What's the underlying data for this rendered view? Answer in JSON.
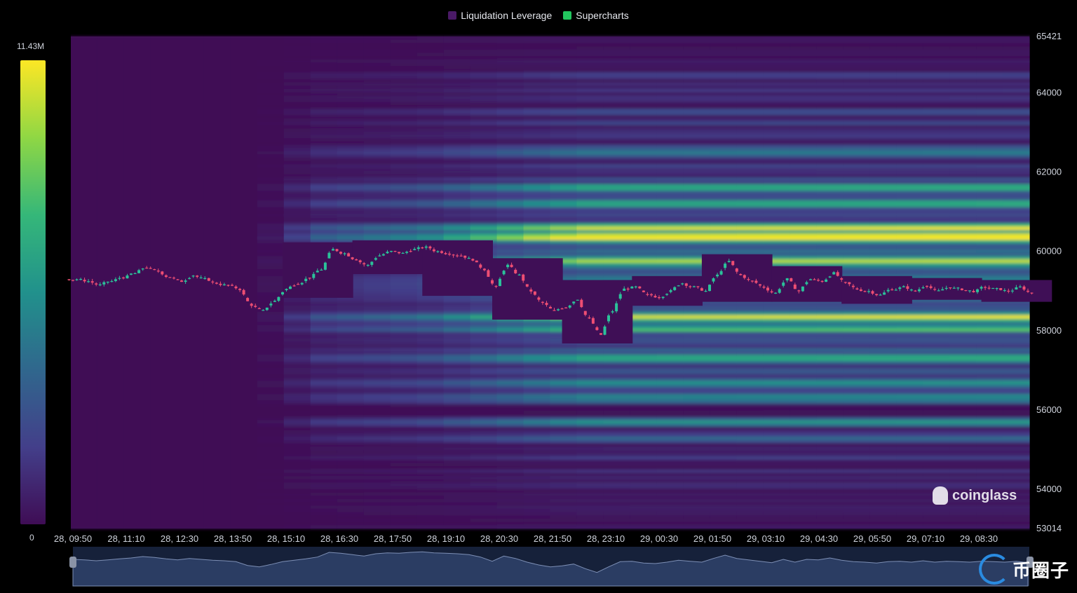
{
  "legend": {
    "items": [
      {
        "label": "Liquidation Leverage",
        "color": "#4a1a66"
      },
      {
        "label": "Supercharts",
        "color": "#22c55e"
      }
    ]
  },
  "colorscale": {
    "max_label": "11.43M",
    "min_label": "0",
    "stops": [
      "#3f0d55",
      "#433f8a",
      "#30678d",
      "#21918c",
      "#35b779",
      "#8fd744",
      "#fde725"
    ]
  },
  "watermark": {
    "text": "coinglass"
  },
  "brand": {
    "text": "币圈子"
  },
  "chart_data": {
    "type": "heatmap",
    "title": "",
    "x_ticks": [
      "28, 09:50",
      "28, 11:10",
      "28, 12:30",
      "28, 13:50",
      "28, 15:10",
      "28, 16:30",
      "28, 17:50",
      "28, 19:10",
      "28, 20:30",
      "28, 21:50",
      "28, 23:10",
      "29, 00:30",
      "29, 01:50",
      "29, 03:10",
      "29, 04:30",
      "29, 05:50",
      "29, 07:10",
      "29, 08:30"
    ],
    "y_ticks": [
      "65421",
      "64000",
      "62000",
      "60000",
      "58000",
      "56000",
      "54000",
      "53014"
    ],
    "ylim": [
      53014,
      65421
    ],
    "value_range": [
      0,
      11430000
    ],
    "series": [
      {
        "name": "Supercharts",
        "type": "candlestick",
        "close_path": [
          59300,
          59250,
          59150,
          59250,
          59350,
          59450,
          59600,
          59500,
          59350,
          59250,
          59400,
          59300,
          59200,
          59150,
          59050,
          58650,
          58500,
          58750,
          59050,
          59200,
          59350,
          59550,
          60050,
          59950,
          59800,
          59650,
          59900,
          60000,
          59950,
          60050,
          60100,
          60000,
          59950,
          59900,
          59800,
          59550,
          59100,
          59650,
          59400,
          59000,
          58700,
          58500,
          58600,
          58800,
          58300,
          57900,
          58500,
          59050,
          59100,
          58900,
          58850,
          59000,
          59200,
          59100,
          59000,
          59400,
          59750,
          59400,
          59250,
          59100,
          58950,
          59300,
          59000,
          59300,
          59250,
          59450,
          59200,
          59050,
          59000,
          58900,
          59050,
          59100,
          59000,
          59150,
          59000,
          59100,
          59050,
          59000,
          59100,
          59050,
          59000,
          59100,
          58950
        ]
      }
    ],
    "liquidation_bands": [
      {
        "price": 60350,
        "intensity": 1.0
      },
      {
        "price": 60600,
        "intensity": 0.75
      },
      {
        "price": 59750,
        "intensity": 0.65
      },
      {
        "price": 58350,
        "intensity": 0.7
      },
      {
        "price": 58050,
        "intensity": 0.45
      },
      {
        "price": 61600,
        "intensity": 0.5
      },
      {
        "price": 61200,
        "intensity": 0.45
      },
      {
        "price": 62500,
        "intensity": 0.4
      },
      {
        "price": 57300,
        "intensity": 0.45
      },
      {
        "price": 56700,
        "intensity": 0.45
      },
      {
        "price": 56300,
        "intensity": 0.4
      },
      {
        "price": 55700,
        "intensity": 0.35
      },
      {
        "price": 55300,
        "intensity": 0.3
      }
    ],
    "grid": false,
    "legend_position": "top-center"
  }
}
